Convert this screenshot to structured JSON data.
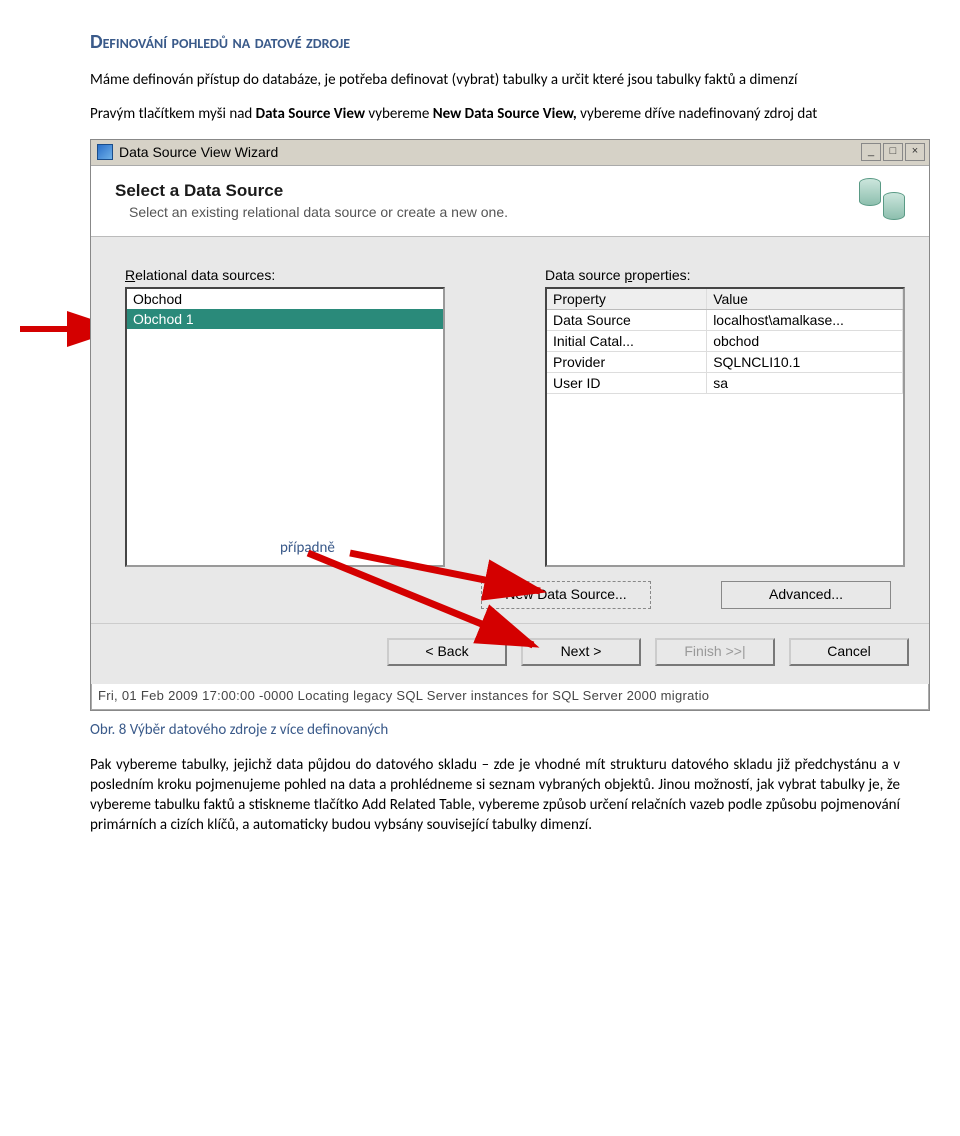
{
  "doc": {
    "heading": "Definování pohledů na datové zdroje",
    "para1_a": "Máme definován přístup do databáze, je potřeba definovat (vybrat)  tabulky a určit které jsou tabulky faktů a dimenzí",
    "para2_a": "Pravým tlačítkem myši nad ",
    "para2_b": "Data Source View",
    "para2_c": " vybereme ",
    "para2_d": "New Data Source View,",
    "para2_e": " vybereme dříve nadefinovaný zdroj dat",
    "annot": "případně",
    "caption": "Obr. 8 Výběr datového zdroje z více definovaných",
    "para3": "Pak vybereme tabulky, jejichž data půjdou do datového skladu – zde je vhodné mít strukturu datového skladu již předchystánu a v posledním kroku pojmenujeme pohled na data a prohlédneme si seznam vybraných objektů. Jinou možností, jak vybrat tabulky je, že vybereme tabulku faktů a stiskneme tlačítko Add Related Table, vybereme způsob určení relačních vazeb podle způsobu pojmenování primárních a cizích klíčů, a automaticky budou vybsány související tabulky dimenzí."
  },
  "wizard": {
    "title": "Data Source View Wizard",
    "header": {
      "title": "Select a Data Source",
      "sub": "Select an existing relational data source or create a new one."
    },
    "labels": {
      "left": "Relational data sources:",
      "right": "Data source properties:"
    },
    "sources": [
      {
        "name": "Obchod",
        "selected": false
      },
      {
        "name": "Obchod 1",
        "selected": true
      }
    ],
    "props": {
      "header": {
        "c1": "Property",
        "c2": "Value"
      },
      "rows": [
        {
          "c1": "Data Source",
          "c2": "localhost\\amalkase..."
        },
        {
          "c1": "Initial Catal...",
          "c2": "obchod"
        },
        {
          "c1": "Provider",
          "c2": "SQLNCLI10.1"
        },
        {
          "c1": "User ID",
          "c2": "sa"
        }
      ]
    },
    "buttons": {
      "newds": "New Data Source...",
      "adv": "Advanced..."
    },
    "nav": {
      "back": "< Back",
      "next": "Next >",
      "finish": "Finish >>|",
      "cancel": "Cancel"
    },
    "logstrip": "Fri, 01 Feb 2009 17:00:00 -0000   Locating legacy SQL Server instances for SQL Server 2000 migratio"
  }
}
